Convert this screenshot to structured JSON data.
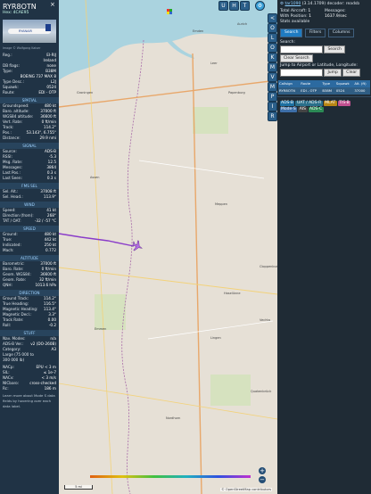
{
  "sidebar": {
    "callsign": "RYR8OTN",
    "hex": "Hex: 4CAE95",
    "photo_logo": "RYANAIR",
    "photo_credit": "Image © Wolfgang Kaiser",
    "info": [
      {
        "label": "Reg.:",
        "value": "EI-RIJ"
      },
      {
        "label": "",
        "value": "Ireland"
      },
      {
        "label": "DB flags:",
        "value": "none"
      },
      {
        "label": "Type:",
        "value": "B38M"
      },
      {
        "label": "",
        "value": "BOEING 737 MAX 8"
      },
      {
        "label": "Type Desc.:",
        "value": "L2J"
      },
      {
        "label": "Squawk:",
        "value": "0524"
      },
      {
        "label": "Route:",
        "value": "EDI - OTP"
      }
    ],
    "sections": [
      {
        "title": "SPATIAL",
        "rows": [
          {
            "label": "Groundspeed:",
            "value": "480 kt"
          },
          {
            "label": "Baro. altitude:",
            "value": "37000 ft"
          },
          {
            "label": "WGS84 altitude:",
            "value": "36600 ft"
          },
          {
            "label": "Vert. Rate:",
            "value": "0 ft/min"
          },
          {
            "label": "Track:",
            "value": "114.2°"
          },
          {
            "label": "Pos.:",
            "value": "53.143°, 6.755°"
          },
          {
            "label": "Distance:",
            "value": "29.9 nmi"
          }
        ]
      },
      {
        "title": "SIGNAL",
        "rows": [
          {
            "label": "Source:",
            "value": "ADS-B"
          },
          {
            "label": "RSSI:",
            "value": "-5.3"
          },
          {
            "label": "Msg. Rate:",
            "value": "12.5"
          },
          {
            "label": "Messages:",
            "value": "3864"
          },
          {
            "label": "Last Pos.:",
            "value": "0.3 s"
          },
          {
            "label": "Last Seen:",
            "value": "0.3 s"
          }
        ]
      },
      {
        "title": "FMS SEL",
        "rows": [
          {
            "label": "Sel. Alt.:",
            "value": "37008 ft"
          },
          {
            "label": "Sel. Head.:",
            "value": "113.9°"
          }
        ]
      },
      {
        "title": "WIND",
        "rows": [
          {
            "label": "Speed:",
            "value": "41 kt"
          },
          {
            "label": "Direction (from):",
            "value": "268°"
          },
          {
            "label": "TAT / OAT:",
            "value": "-32 / -57 °C"
          }
        ]
      },
      {
        "title": "SPEED",
        "rows": [
          {
            "label": "Ground:",
            "value": "480 kt"
          },
          {
            "label": "True:",
            "value": "442 kt"
          },
          {
            "label": "Indicated:",
            "value": "250 kt"
          },
          {
            "label": "Mach:",
            "value": "0.772"
          }
        ]
      },
      {
        "title": "ALTITUDE",
        "rows": [
          {
            "label": "Barometric:",
            "value": "37000 ft"
          },
          {
            "label": "Baro. Rate:",
            "value": "0 ft/min"
          },
          {
            "label": "Geom. WGS84:",
            "value": "36600 ft"
          },
          {
            "label": "Geom. Rate:",
            "value": "32 ft/min"
          },
          {
            "label": "QNH:",
            "value": "1013.6 hPa"
          }
        ]
      },
      {
        "title": "DIRECTION",
        "rows": [
          {
            "label": "Ground Track:",
            "value": "114.2°"
          },
          {
            "label": "True Heading:",
            "value": "116.5°"
          },
          {
            "label": "Magnetic Heading:",
            "value": "113.4°"
          },
          {
            "label": "Magnetic Decl.:",
            "value": "3.3°"
          },
          {
            "label": "Track Rate:",
            "value": "0.00"
          },
          {
            "label": "Roll:",
            "value": "-0.2"
          }
        ]
      },
      {
        "title": "STUFF",
        "rows": [
          {
            "label": "Nav. Modes:",
            "value": "n/a"
          },
          {
            "label": "ADS-B Ver.:",
            "value": "v2 (DO-260B)"
          },
          {
            "label": "Category:",
            "value": "A3"
          },
          {
            "label": "Large (75 000 to",
            "value": ""
          },
          {
            "label": "300 000 lb)",
            "value": ""
          }
        ]
      }
    ],
    "nav_rows": [
      {
        "label": "NACp:",
        "value": "EPU < 3 m"
      },
      {
        "label": "SIL:",
        "value": "≤ 1e-7"
      },
      {
        "label": "NACv:",
        "value": "< 3 m/s"
      },
      {
        "label": "NICbaro:",
        "value": "cross-checked"
      },
      {
        "label": "Rc:",
        "value": "186 m"
      }
    ],
    "footer": "Learn more about Mode S data fields by hovering over each data label."
  },
  "map": {
    "top_buttons": [
      "U",
      "H",
      "T"
    ],
    "right_buttons": [
      "<",
      "O",
      "L",
      "O",
      "K",
      "M",
      "V",
      "M",
      "P",
      "I",
      "R"
    ],
    "places": [
      {
        "name": "Emden"
      },
      {
        "name": "Aurich"
      },
      {
        "name": "Leer"
      },
      {
        "name": "Papenburg"
      },
      {
        "name": "Groningen"
      },
      {
        "name": "Assen"
      },
      {
        "name": "Meppen"
      },
      {
        "name": "Lingen"
      },
      {
        "name": "Emmen"
      },
      {
        "name": "Nordhorn"
      },
      {
        "name": "Cloppenburg"
      },
      {
        "name": "Vechta"
      },
      {
        "name": "Quakenbrück"
      },
      {
        "name": "Haselünne"
      }
    ],
    "scale": "5 mi",
    "attribution": "© OpenStreetMap contributors",
    "zoom_in": "+",
    "zoom_out": "−"
  },
  "panel": {
    "brand": "tar1090",
    "version": "(3.14.1709) decoder: readsb",
    "total_label": "Total Aircraft:",
    "total_value": "1",
    "messages_label": "Messages:",
    "messages_value": "1637.9/sec",
    "with_position_label": "With Position:",
    "with_position_value": "1",
    "stats": "Stats available",
    "tabs": [
      "Search",
      "Filters",
      "Columns"
    ],
    "search_label": "Search:",
    "search_button": "Search",
    "clear_search": "Clear Search",
    "jump_label": "Jump to Airport or Latitude, Longitude:",
    "jump_button": "Jump",
    "clear_button": "Clear",
    "table": {
      "headers": [
        "Callsign",
        "Route",
        "Type",
        "Squawk",
        "Alt. (ft)"
      ],
      "rows": [
        [
          "RYR8OTN",
          "EDI - OTP",
          "B38M",
          "0524",
          "37000"
        ]
      ]
    },
    "tags": [
      "ADS-B",
      "UAT / ADS-R",
      "MLAT",
      "TIS-B",
      "Mode-S",
      "AIS",
      "ADS-C"
    ]
  },
  "colors": {
    "track": "#8a3cc9",
    "tag_adsb": "#1d6fa0",
    "tag_uat": "#2a6f8a",
    "tag_mlat": "#b88614",
    "tag_tisb": "#c05090",
    "tag_modes": "#3d6fa8",
    "tag_ais": "#444444",
    "tag_adsc": "#2b8a55"
  }
}
